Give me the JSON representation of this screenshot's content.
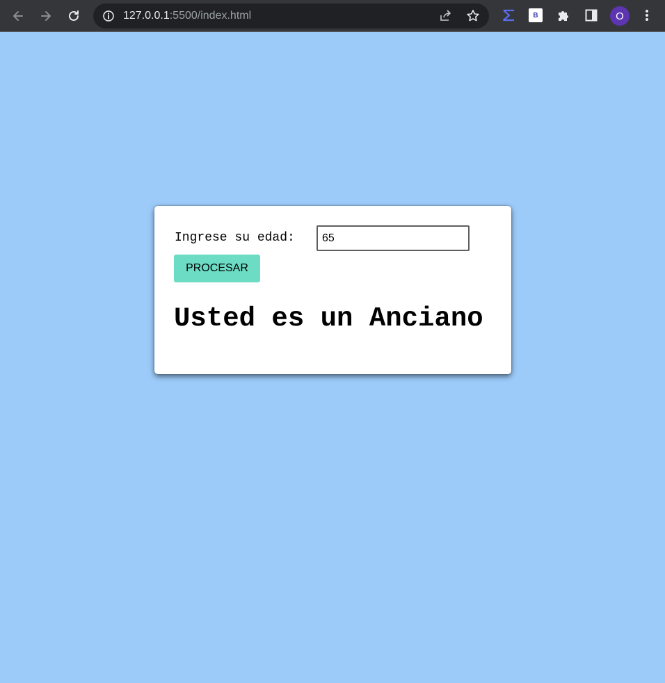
{
  "browser": {
    "url_host": "127.0.0.1",
    "url_rest": ":5500/index.html",
    "extension_b_label": "B",
    "profile_initial": "O"
  },
  "form": {
    "age_label": "Ingrese su edad:",
    "age_value": "65",
    "process_button": "PROCESAR",
    "result_text": "Usted es un Anciano"
  },
  "colors": {
    "page_background": "#9ccaf9",
    "button_background": "#6cdcc5",
    "toolbar_background": "#35363a"
  }
}
